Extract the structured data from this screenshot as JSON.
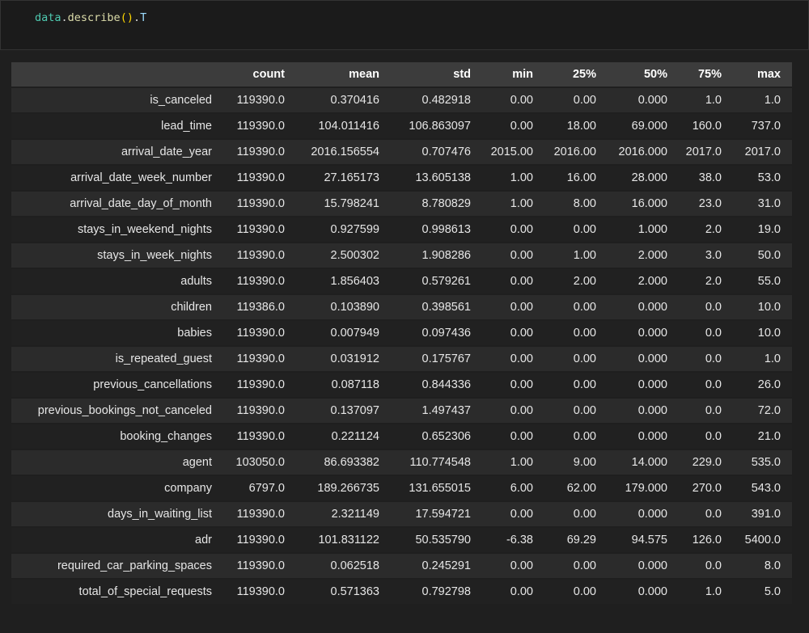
{
  "code_cell": {
    "code_plain": "data.describe().T",
    "tokens": [
      {
        "text": "data",
        "color": "#4ec9b0"
      },
      {
        "text": ".",
        "color": "#d4d4d4"
      },
      {
        "text": "describe",
        "color": "#dcdcaa"
      },
      {
        "text": "(",
        "color": "#ffd700"
      },
      {
        "text": ")",
        "color": "#ffd700"
      },
      {
        "text": ".",
        "color": "#d4d4d4"
      },
      {
        "text": "T",
        "color": "#9cdcfe"
      }
    ]
  },
  "theme": {
    "page_bg": "#1f1f1f",
    "code_cell_bg": "#1b1b1b",
    "header_bg": "#3c3c3c",
    "row_odd_bg": "#2b2b2b",
    "row_even_bg": "#212121",
    "text_color": "#e6e6e6"
  },
  "table": {
    "columns": [
      "",
      "count",
      "mean",
      "std",
      "min",
      "25%",
      "50%",
      "75%",
      "max"
    ],
    "rows": [
      {
        "label": "is_canceled",
        "values": [
          "119390.0",
          "0.370416",
          "0.482918",
          "0.00",
          "0.00",
          "0.000",
          "1.0",
          "1.0"
        ]
      },
      {
        "label": "lead_time",
        "values": [
          "119390.0",
          "104.011416",
          "106.863097",
          "0.00",
          "18.00",
          "69.000",
          "160.0",
          "737.0"
        ]
      },
      {
        "label": "arrival_date_year",
        "values": [
          "119390.0",
          "2016.156554",
          "0.707476",
          "2015.00",
          "2016.00",
          "2016.000",
          "2017.0",
          "2017.0"
        ]
      },
      {
        "label": "arrival_date_week_number",
        "values": [
          "119390.0",
          "27.165173",
          "13.605138",
          "1.00",
          "16.00",
          "28.000",
          "38.0",
          "53.0"
        ]
      },
      {
        "label": "arrival_date_day_of_month",
        "values": [
          "119390.0",
          "15.798241",
          "8.780829",
          "1.00",
          "8.00",
          "16.000",
          "23.0",
          "31.0"
        ]
      },
      {
        "label": "stays_in_weekend_nights",
        "values": [
          "119390.0",
          "0.927599",
          "0.998613",
          "0.00",
          "0.00",
          "1.000",
          "2.0",
          "19.0"
        ]
      },
      {
        "label": "stays_in_week_nights",
        "values": [
          "119390.0",
          "2.500302",
          "1.908286",
          "0.00",
          "1.00",
          "2.000",
          "3.0",
          "50.0"
        ]
      },
      {
        "label": "adults",
        "values": [
          "119390.0",
          "1.856403",
          "0.579261",
          "0.00",
          "2.00",
          "2.000",
          "2.0",
          "55.0"
        ]
      },
      {
        "label": "children",
        "values": [
          "119386.0",
          "0.103890",
          "0.398561",
          "0.00",
          "0.00",
          "0.000",
          "0.0",
          "10.0"
        ]
      },
      {
        "label": "babies",
        "values": [
          "119390.0",
          "0.007949",
          "0.097436",
          "0.00",
          "0.00",
          "0.000",
          "0.0",
          "10.0"
        ]
      },
      {
        "label": "is_repeated_guest",
        "values": [
          "119390.0",
          "0.031912",
          "0.175767",
          "0.00",
          "0.00",
          "0.000",
          "0.0",
          "1.0"
        ]
      },
      {
        "label": "previous_cancellations",
        "values": [
          "119390.0",
          "0.087118",
          "0.844336",
          "0.00",
          "0.00",
          "0.000",
          "0.0",
          "26.0"
        ]
      },
      {
        "label": "previous_bookings_not_canceled",
        "values": [
          "119390.0",
          "0.137097",
          "1.497437",
          "0.00",
          "0.00",
          "0.000",
          "0.0",
          "72.0"
        ]
      },
      {
        "label": "booking_changes",
        "values": [
          "119390.0",
          "0.221124",
          "0.652306",
          "0.00",
          "0.00",
          "0.000",
          "0.0",
          "21.0"
        ]
      },
      {
        "label": "agent",
        "values": [
          "103050.0",
          "86.693382",
          "110.774548",
          "1.00",
          "9.00",
          "14.000",
          "229.0",
          "535.0"
        ]
      },
      {
        "label": "company",
        "values": [
          "6797.0",
          "189.266735",
          "131.655015",
          "6.00",
          "62.00",
          "179.000",
          "270.0",
          "543.0"
        ]
      },
      {
        "label": "days_in_waiting_list",
        "values": [
          "119390.0",
          "2.321149",
          "17.594721",
          "0.00",
          "0.00",
          "0.000",
          "0.0",
          "391.0"
        ]
      },
      {
        "label": "adr",
        "values": [
          "119390.0",
          "101.831122",
          "50.535790",
          "-6.38",
          "69.29",
          "94.575",
          "126.0",
          "5400.0"
        ]
      },
      {
        "label": "required_car_parking_spaces",
        "values": [
          "119390.0",
          "0.062518",
          "0.245291",
          "0.00",
          "0.00",
          "0.000",
          "0.0",
          "8.0"
        ]
      },
      {
        "label": "total_of_special_requests",
        "values": [
          "119390.0",
          "0.571363",
          "0.792798",
          "0.00",
          "0.00",
          "0.000",
          "1.0",
          "5.0"
        ]
      }
    ]
  }
}
